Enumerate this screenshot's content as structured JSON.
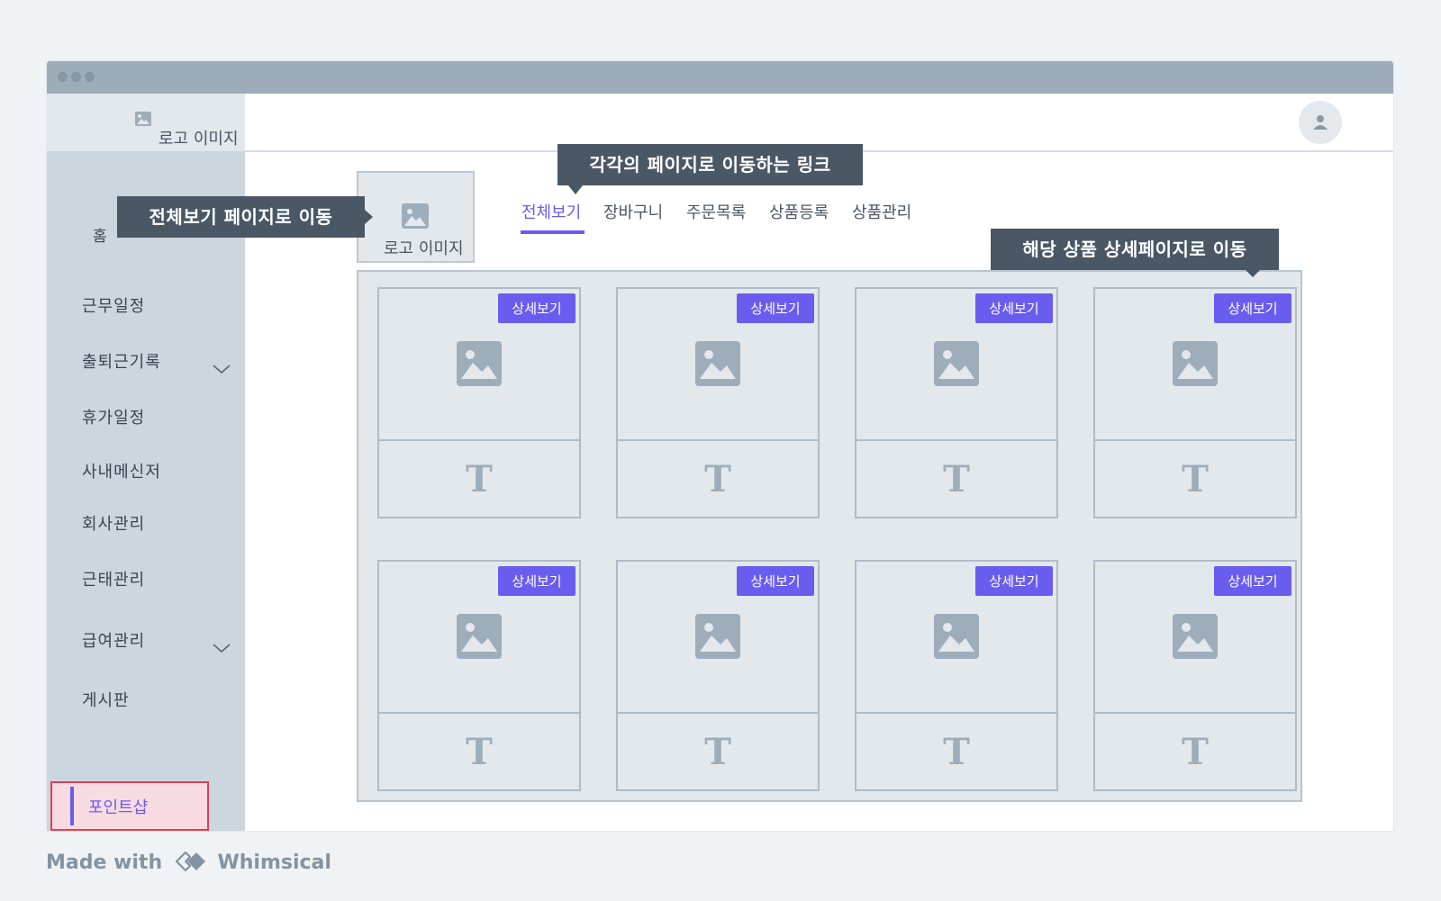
{
  "sidebar": {
    "logo_text": "로고 이미지",
    "home": "홈",
    "items": [
      {
        "label": "근무일정"
      },
      {
        "label": "출퇴근기록"
      },
      {
        "label": "휴가일정"
      },
      {
        "label": "사내메신저"
      },
      {
        "label": "회사관리"
      },
      {
        "label": "근태관리"
      },
      {
        "label": "급여관리"
      },
      {
        "label": "게시판"
      }
    ],
    "active_item": "포인트샵"
  },
  "content": {
    "logo_text": "로고 이미지",
    "nav": [
      "전체보기",
      "장바구니",
      "주문목록",
      "상품등록",
      "상품관리"
    ],
    "active_nav": "전체보기"
  },
  "cards": [
    {
      "button": "상세보기",
      "text_icon": "T"
    },
    {
      "button": "상세보기",
      "text_icon": "T"
    },
    {
      "button": "상세보기",
      "text_icon": "T"
    },
    {
      "button": "상세보기",
      "text_icon": "T"
    },
    {
      "button": "상세보기",
      "text_icon": "T"
    },
    {
      "button": "상세보기",
      "text_icon": "T"
    },
    {
      "button": "상세보기",
      "text_icon": "T"
    },
    {
      "button": "상세보기",
      "text_icon": "T"
    }
  ],
  "annotations": {
    "nav_links": "각각의 페이지로 이동하는 링크",
    "logo_link": "전체보기 페이지로 이동",
    "detail_link": "해당 상품 상세페이지로 이동"
  },
  "footer": {
    "made_with": "Made with",
    "brand": "Whimsical"
  },
  "colors": {
    "accent": "#6b5cf0",
    "sidebar_bg": "#ccd6df",
    "tooltip_bg": "#4a5866",
    "active_border": "#e33d57"
  },
  "icons": [
    "image-icon",
    "user-icon",
    "chevron-down-icon",
    "text-icon",
    "whimsical-logo-icon"
  ]
}
